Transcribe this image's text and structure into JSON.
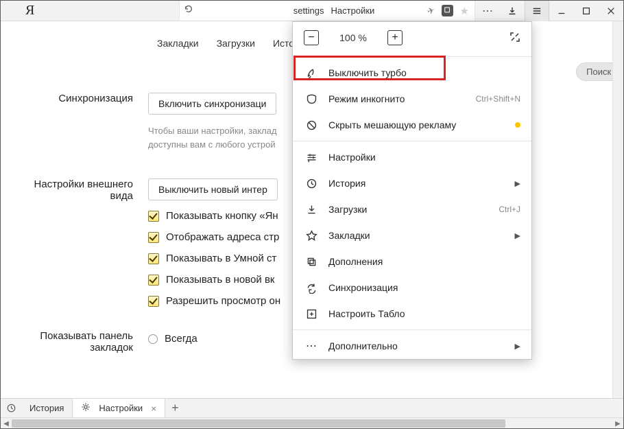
{
  "titlebar": {
    "url_label": "settings",
    "page_title": "Настройки"
  },
  "topnav": {
    "bookmarks": "Закладки",
    "downloads": "Загрузки",
    "history_cut": "Исто"
  },
  "search_placeholder": "Поиск н",
  "sync": {
    "label": "Синхронизация",
    "button": "Включить синхронизаци",
    "hint1": "Чтобы ваши настройки, заклад",
    "hint2": "доступны вам с любого устрой"
  },
  "appearance": {
    "label": "Настройки внешнего\nвида",
    "button": "Выключить новый интер",
    "c1": "Показывать кнопку «Ян",
    "c2": "Отображать адреса стр",
    "c3": "Показывать в Умной ст",
    "c4": "Показывать в новой вк",
    "c5": "Разрешить просмотр он"
  },
  "bookbar": {
    "label": "Показывать панель\nзакладок",
    "always": "Всегда"
  },
  "menu": {
    "zoom_value": "100 %",
    "turbo_off": "Выключить турбо",
    "incognito": "Режим инкогнито",
    "incognito_sc": "Ctrl+Shift+N",
    "hide_ads": "Скрыть мешающую рекламу",
    "settings": "Настройки",
    "history": "История",
    "downloads": "Загрузки",
    "downloads_sc": "Ctrl+J",
    "bookmarks": "Закладки",
    "addons": "Дополнения",
    "sync": "Синхронизация",
    "tableau": "Настроить Табло",
    "more": "Дополнительно"
  },
  "tabs": {
    "history": "История",
    "settings": "Настройки"
  }
}
